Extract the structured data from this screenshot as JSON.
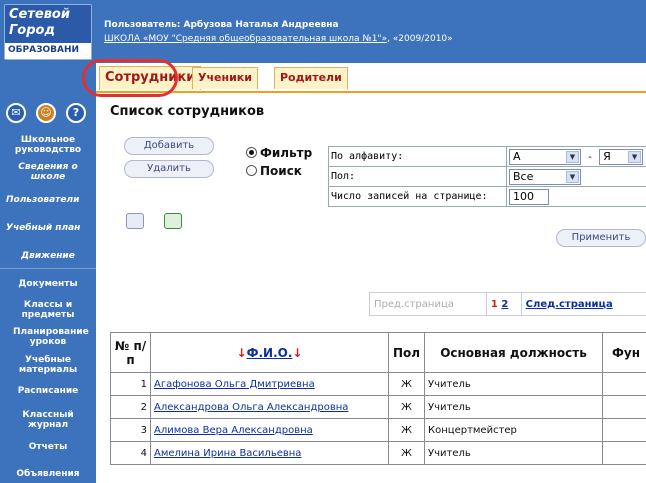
{
  "logo": {
    "line1": "Сетевой",
    "line2": "Город",
    "line3": "ОБРАЗОВАНИ"
  },
  "sidebar": {
    "icons": [
      "mail-icon",
      "forum-icon",
      "help-icon"
    ],
    "items": [
      {
        "label": "Школьное руководство",
        "sub": "Сведения о школе"
      },
      {
        "label": "Пользователи"
      },
      {
        "label": "Учебный план"
      },
      {
        "label": "Движение"
      },
      {
        "label": "Документы"
      },
      {
        "label": "Классы и предметы"
      },
      {
        "label": "Планирование уроков"
      },
      {
        "label": "Учебные материалы"
      },
      {
        "label": "Расписание"
      },
      {
        "label": "Классный журнал"
      },
      {
        "label": "Отчеты"
      },
      {
        "label": "Объявления"
      }
    ]
  },
  "header": {
    "user": "Пользователь: Арбузова Наталья Андреевна",
    "school_link": "ШКОЛА «МОУ \"Средняя общеобразовательная школа №1\"»",
    "year": ", «2009/2010»"
  },
  "tabs": [
    {
      "label": "Сотрудники",
      "selected": true
    },
    {
      "label": "Ученики"
    },
    {
      "label": "Родители"
    }
  ],
  "page_title": "Список сотрудников",
  "actions": {
    "add": "Добавить",
    "delete": "Удалить"
  },
  "mode": {
    "filter": "Фильтр",
    "search": "Поиск",
    "selected": "filter"
  },
  "filter": {
    "alpha_label": "По алфавиту:",
    "alpha_from": "А",
    "alpha_sep": "-",
    "alpha_to": "Я",
    "sex_label": "Пол:",
    "sex_value": "Все",
    "per_page_label": "Число записей на странице:",
    "per_page_value": "100",
    "apply": "Применить"
  },
  "pager": {
    "prev": "Пред.страница",
    "current": "1",
    "page2": "2",
    "next": "След.страница"
  },
  "table": {
    "headers": {
      "num": "№ п/п",
      "name": "Ф.И.О.",
      "sex": "Пол",
      "position": "Основная должность",
      "func": "Фун"
    },
    "rows": [
      {
        "num": "1",
        "name": "Агафонова Ольга Дмитриевна",
        "sex": "Ж",
        "position": "Учитель"
      },
      {
        "num": "2",
        "name": "Александрова Ольга Александровна",
        "sex": "Ж",
        "position": "Учитель"
      },
      {
        "num": "3",
        "name": "Алимова Вера Александровна",
        "sex": "Ж",
        "position": "Концертмейстер"
      },
      {
        "num": "4",
        "name": "Амелина Ирина Васильевна",
        "sex": "Ж",
        "position": "Учитель"
      }
    ]
  },
  "colors": {
    "brand": "#3d72bd",
    "tab_text": "#a01818",
    "highlight": "#e03030"
  }
}
